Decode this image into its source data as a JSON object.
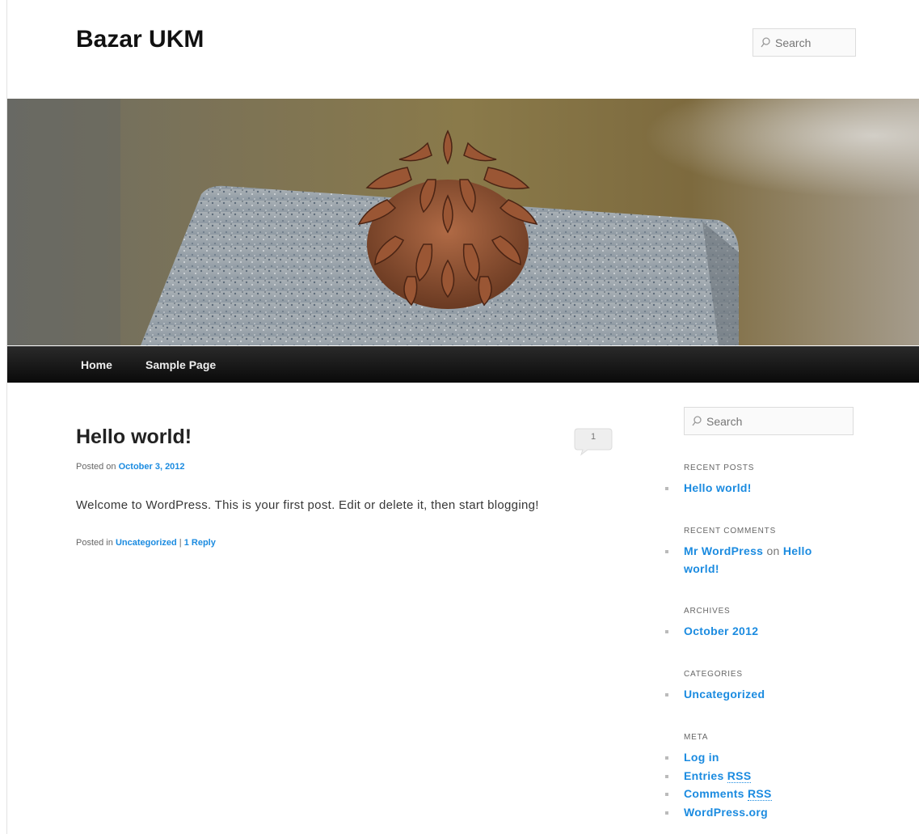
{
  "site": {
    "title": "Bazar UKM"
  },
  "header_search": {
    "placeholder": "Search"
  },
  "nav": {
    "items": [
      {
        "label": "Home"
      },
      {
        "label": "Sample Page"
      }
    ]
  },
  "post": {
    "title": "Hello world!",
    "posted_on_prefix": "Posted on",
    "date": "October 3, 2012",
    "comment_count": "1",
    "body": "Welcome to WordPress. This is your first post. Edit or delete it, then start blogging!",
    "posted_in_prefix": "Posted in",
    "category": "Uncategorized",
    "separator": "|",
    "reply_link": "1 Reply"
  },
  "sidebar": {
    "search_placeholder": "Search",
    "recent_posts": {
      "title": "RECENT POSTS",
      "items": [
        "Hello world!"
      ]
    },
    "recent_comments": {
      "title": "RECENT COMMENTS",
      "author": "Mr WordPress",
      "on": "on",
      "post_line1": "Hello",
      "post_line2": "world!"
    },
    "archives": {
      "title": "ARCHIVES",
      "items": [
        "October 2012"
      ]
    },
    "categories": {
      "title": "CATEGORIES",
      "items": [
        "Uncategorized"
      ]
    },
    "meta": {
      "title": "META",
      "log_in": "Log in",
      "entries": "Entries",
      "comments": "Comments",
      "rss": "RSS",
      "wordpress_org": "WordPress.org"
    }
  },
  "colors": {
    "link": "#1b8be0",
    "nav_bg": "#111111",
    "text": "#373737"
  },
  "icons": {
    "search": "search-icon",
    "comment": "comment-bubble-icon"
  }
}
